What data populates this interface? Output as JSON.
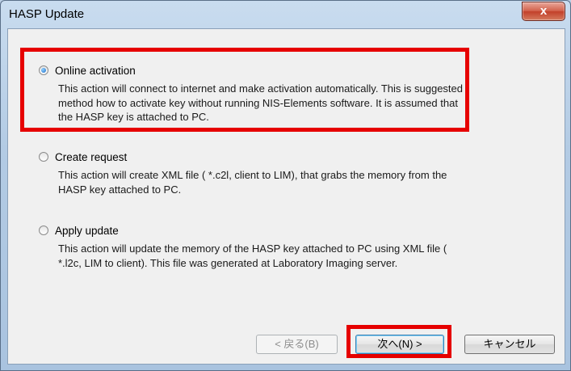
{
  "window": {
    "title": "HASP Update",
    "close_label": "x"
  },
  "options": [
    {
      "label": "Online activation",
      "checked": true,
      "description": "This action will connect to internet and make activation automatically. This is suggested method how to activate key without running NIS-Elements software. It is assumed that the HASP key is attached to PC."
    },
    {
      "label": "Create request",
      "checked": false,
      "description": "This action will create XML file ( *.c2l, client to LIM), that grabs the memory from the HASP key attached to PC."
    },
    {
      "label": "Apply update",
      "checked": false,
      "description": "This action will update the memory of the HASP key attached to PC using XML file ( *.l2c, LIM to client). This file was generated at Laboratory Imaging server."
    }
  ],
  "buttons": {
    "back": "< 戻る(B)",
    "next": "次へ(N) >",
    "cancel": "キャンセル"
  },
  "colors": {
    "highlight": "#e60000",
    "close_button": "#c2402a"
  }
}
